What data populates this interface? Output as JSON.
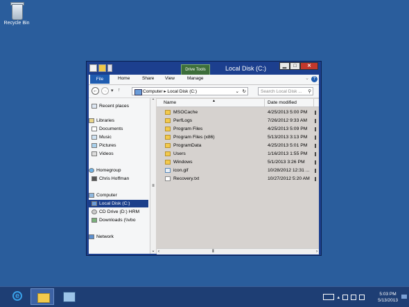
{
  "desktop": {
    "recycle_bin_label": "Recycle Bin"
  },
  "window": {
    "title": "Local Disk (C:)",
    "context_tab": "Drive Tools",
    "controls": {
      "minimize": "▁",
      "maximize": "□",
      "close": "✕"
    },
    "ribbon_tabs": [
      "File",
      "Home",
      "Share",
      "View",
      "Manage"
    ],
    "help": "?",
    "address": {
      "path": "Computer ▸ Local Disk (C:)",
      "search_placeholder": "Search Local Disk ..."
    },
    "nav": {
      "back": "←",
      "forward": "→",
      "recent": "▾",
      "up": "↑"
    },
    "navpane": {
      "items": [
        {
          "label": "Recent places",
          "icon": "recent-places-icon"
        },
        {
          "label": "Libraries",
          "icon": "libraries-icon"
        },
        {
          "label": "Documents",
          "icon": "documents-icon"
        },
        {
          "label": "Music",
          "icon": "music-icon"
        },
        {
          "label": "Pictures",
          "icon": "pictures-icon"
        },
        {
          "label": "Videos",
          "icon": "videos-icon"
        },
        {
          "label": "Homegroup",
          "icon": "homegroup-icon"
        },
        {
          "label": "Chris Hoffman",
          "icon": "user-icon"
        },
        {
          "label": "Computer",
          "icon": "computer-icon"
        },
        {
          "label": "Local Disk (C:)",
          "icon": "drive-icon"
        },
        {
          "label": "CD Drive (D:) HRM",
          "icon": "cd-drive-icon"
        },
        {
          "label": "Downloads (\\\\vbo",
          "icon": "network-drive-icon"
        },
        {
          "label": "Network",
          "icon": "network-icon"
        }
      ]
    },
    "columns": {
      "name": "Name",
      "date": "Date modified"
    },
    "files": [
      {
        "name": "MSOCache",
        "date": "4/25/2013 5:00 PM",
        "type": "folder"
      },
      {
        "name": "PerfLogs",
        "date": "7/26/2012 9:33 AM",
        "type": "folder"
      },
      {
        "name": "Program Files",
        "date": "4/25/2013 5:09 PM",
        "type": "folder"
      },
      {
        "name": "Program Files (x86)",
        "date": "5/13/2013 3:13 PM",
        "type": "folder"
      },
      {
        "name": "ProgramData",
        "date": "4/25/2013 5:01 PM",
        "type": "folder"
      },
      {
        "name": "Users",
        "date": "1/16/2013 1:55 PM",
        "type": "folder"
      },
      {
        "name": "Windows",
        "date": "5/1/2013 3:26 PM",
        "type": "folder"
      },
      {
        "name": "icon.gif",
        "date": "10/28/2012 12:31 ...",
        "type": "image"
      },
      {
        "name": "Recovery.txt",
        "date": "10/27/2012 5:20 AM",
        "type": "text"
      }
    ]
  },
  "taskbar": {
    "clock_time": "5:03 PM",
    "clock_date": "5/13/2013"
  }
}
